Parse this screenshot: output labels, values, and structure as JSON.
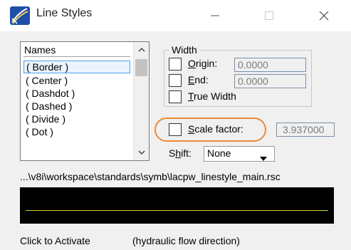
{
  "window": {
    "title": "Line Styles",
    "icon": "line-styles-app-icon",
    "controls": {
      "minimize": "minimize-icon",
      "maximize": "maximize-icon",
      "close": "close-icon"
    }
  },
  "names_list": {
    "header": "Names",
    "items": [
      "( Border )",
      "( Center )",
      "( Dashdot )",
      "( Dashed )",
      "( Divide )",
      "( Dot )"
    ],
    "selected_index": 0
  },
  "width": {
    "legend": "Width",
    "origin": {
      "label_pre": "",
      "label_key": "O",
      "label_rest": "rigin:",
      "value": "0.0000",
      "checked": false
    },
    "end": {
      "label_pre": "",
      "label_key": "E",
      "label_rest": "nd:",
      "value": "0.0000",
      "checked": false
    },
    "true_width": {
      "label_pre": "",
      "label_key": "T",
      "label_rest": "rue Width",
      "checked": false
    }
  },
  "scale_factor": {
    "label_pre": "",
    "label_key": "S",
    "label_rest": "cale factor:",
    "value": "3.937000",
    "checked": false
  },
  "shift": {
    "label_pre": "S",
    "label_key": "h",
    "label_rest": "ift:",
    "value": "None"
  },
  "resource_path": "...\\v8i\\workspace\\standards\\symb\\lacpw_linestyle_main.rsc",
  "preview": {
    "line_color": "#d9cc2e",
    "background": "#000000"
  },
  "status": {
    "left": "Click to Activate",
    "right": "(hydraulic flow direction)"
  },
  "colors": {
    "highlight_oval": "#ec8a35",
    "selection_border": "#4ea3ea"
  }
}
